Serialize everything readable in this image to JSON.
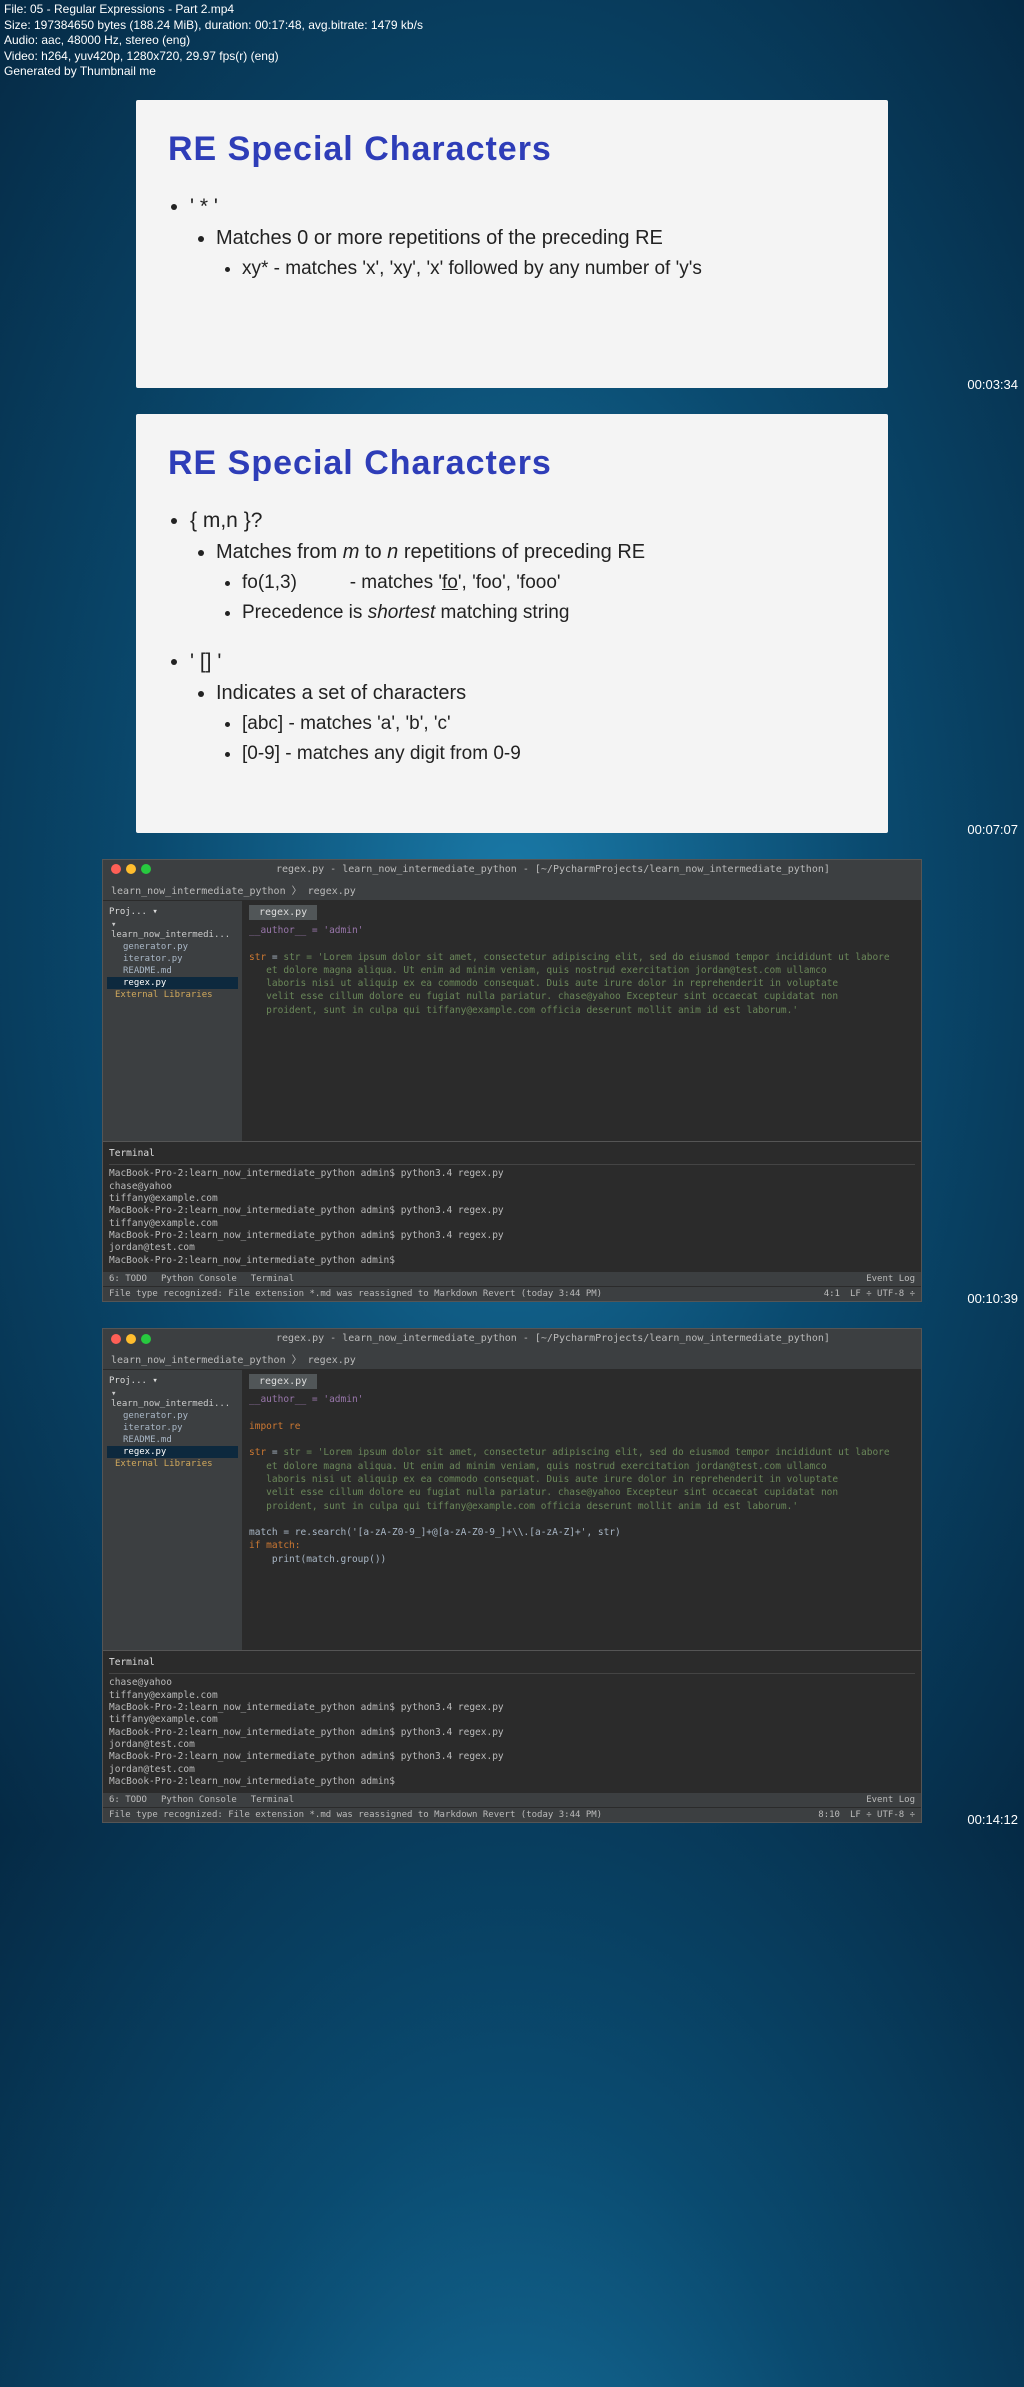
{
  "header": {
    "file": "File: 05 - Regular Expressions - Part 2.mp4",
    "size": "Size: 197384650 bytes (188.24 MiB), duration: 00:17:48, avg.bitrate: 1479 kb/s",
    "audio": "Audio: aac, 48000 Hz, stereo (eng)",
    "video": "Video: h264, yuv420p, 1280x720, 29.97 fps(r) (eng)",
    "gen": "Generated by Thumbnail me"
  },
  "slide1": {
    "title": "RE  Special Characters",
    "b1": "' * '",
    "b1a": "Matches 0 or more repetitions of the preceding RE",
    "b1a1_pre": "xy*    - matches 'x', 'xy', 'x' followed by any number of 'y's",
    "ts": "00:03:34"
  },
  "slide2": {
    "title": "RE  Special Characters",
    "b1": "{ m,n }?",
    "b1a": "Matches from m to n repetitions of preceding RE",
    "b1a1": "fo(1,3)          - matches 'fo', 'foo', 'fooo'",
    "b1a2": "Precedence is shortest matching string",
    "b2": "' [] '",
    "b2a": "Indicates a set of characters",
    "b2a1": "[abc]            - matches 'a', 'b', 'c'",
    "b2a2": "[0-9]             - matches any digit from 0-9",
    "ts": "00:07:07"
  },
  "ide": {
    "title": "regex.py - learn_now_intermediate_python - [~/PycharmProjects/learn_now_intermediate_python]",
    "breadcrumb": "learn_now_intermediate_python 〉 regex.py",
    "tab": "regex.py",
    "project": {
      "root": "learn_now_intermedi...",
      "f1": "generator.py",
      "f2": "iterator.py",
      "f3": "README.md",
      "f4": "regex.py",
      "ext": "External Libraries"
    },
    "code1": {
      "l1": "__author__ = 'admin'",
      "l2": "str = 'Lorem ipsum dolor sit amet, consectetur adipiscing elit, sed do eiusmod tempor incididunt ut labore",
      "l3": "   et dolore magna aliqua. Ut enim ad minim veniam, quis nostrud exercitation jordan@test.com ullamco",
      "l4": "   laboris nisi ut aliquip ex ea commodo consequat. Duis aute irure dolor in reprehenderit in voluptate",
      "l5": "   velit esse cillum dolore eu fugiat nulla pariatur. chase@yahoo Excepteur sint occaecat cupidatat non",
      "l6": "   proident, sunt in culpa qui tiffany@example.com officia deserunt mollit anim id est laborum.'"
    },
    "code2": {
      "l1": "__author__ = 'admin'",
      "l2": "import re",
      "l3": "str = 'Lorem ipsum dolor sit amet, consectetur adipiscing elit, sed do eiusmod tempor incididunt ut labore",
      "l4": "   et dolore magna aliqua. Ut enim ad minim veniam, quis nostrud exercitation jordan@test.com ullamco",
      "l5": "   laboris nisi ut aliquip ex ea commodo consequat. Duis aute irure dolor in reprehenderit in voluptate",
      "l6": "   velit esse cillum dolore eu fugiat nulla pariatur. chase@yahoo Excepteur sint occaecat cupidatat non",
      "l7": "   proident, sunt in culpa qui tiffany@example.com officia deserunt mollit anim id est laborum.'",
      "l8": "match = re.search('[a-zA-Z0-9_]+@[a-zA-Z0-9_]+\\\\.[a-zA-Z]+', str)",
      "l9": "if match:",
      "l10": "    print(match.group())"
    },
    "term1": {
      "header": "Terminal",
      "l1": "MacBook-Pro-2:learn_now_intermediate_python admin$ python3.4 regex.py",
      "l2": "chase@yahoo",
      "l3": "tiffany@example.com",
      "l4": "MacBook-Pro-2:learn_now_intermediate_python admin$ python3.4 regex.py",
      "l5": "tiffany@example.com",
      "l6": "MacBook-Pro-2:learn_now_intermediate_python admin$ python3.4 regex.py",
      "l7": "jordan@test.com",
      "l8": "MacBook-Pro-2:learn_now_intermediate_python admin$ "
    },
    "term2": {
      "l1": "chase@yahoo",
      "l2": "tiffany@example.com",
      "l3": "MacBook-Pro-2:learn_now_intermediate_python admin$ python3.4 regex.py",
      "l4": "tiffany@example.com",
      "l5": "MacBook-Pro-2:learn_now_intermediate_python admin$ python3.4 regex.py",
      "l6": "jordan@test.com",
      "l7": "MacBook-Pro-2:learn_now_intermediate_python admin$ python3.4 regex.py",
      "l8": "jordan@test.com",
      "l9": "MacBook-Pro-2:learn_now_intermediate_python admin$ "
    },
    "bottom": {
      "todo": "6: TODO",
      "pc": "Python Console",
      "term": "Terminal",
      "event": "Event Log"
    },
    "status": {
      "msg": "File type recognized: File extension *.md was reassigned to Markdown Revert (today 3:44 PM)",
      "pos1": "4:1",
      "pos2": "8:10",
      "enc": "LF ÷ UTF-8 ÷"
    },
    "ts1": "00:10:39",
    "ts2": "00:14:12"
  }
}
